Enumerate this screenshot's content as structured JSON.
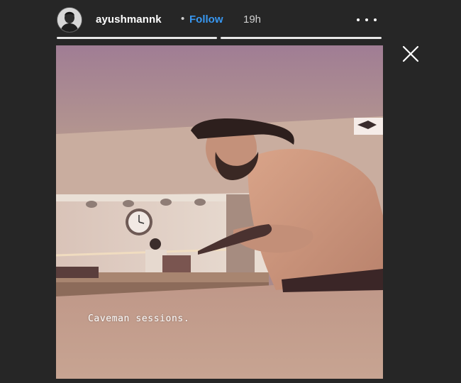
{
  "story": {
    "username": "ayushmannk",
    "separator": "•",
    "follow_label": "Follow",
    "time": "19h",
    "progress_segments": 2,
    "caption": "Caveman sessions."
  },
  "icons": {
    "more": "more-options-icon",
    "close": "close-icon"
  },
  "colors": {
    "background": "#262626",
    "follow": "#3897f0",
    "text": "#ffffff"
  }
}
